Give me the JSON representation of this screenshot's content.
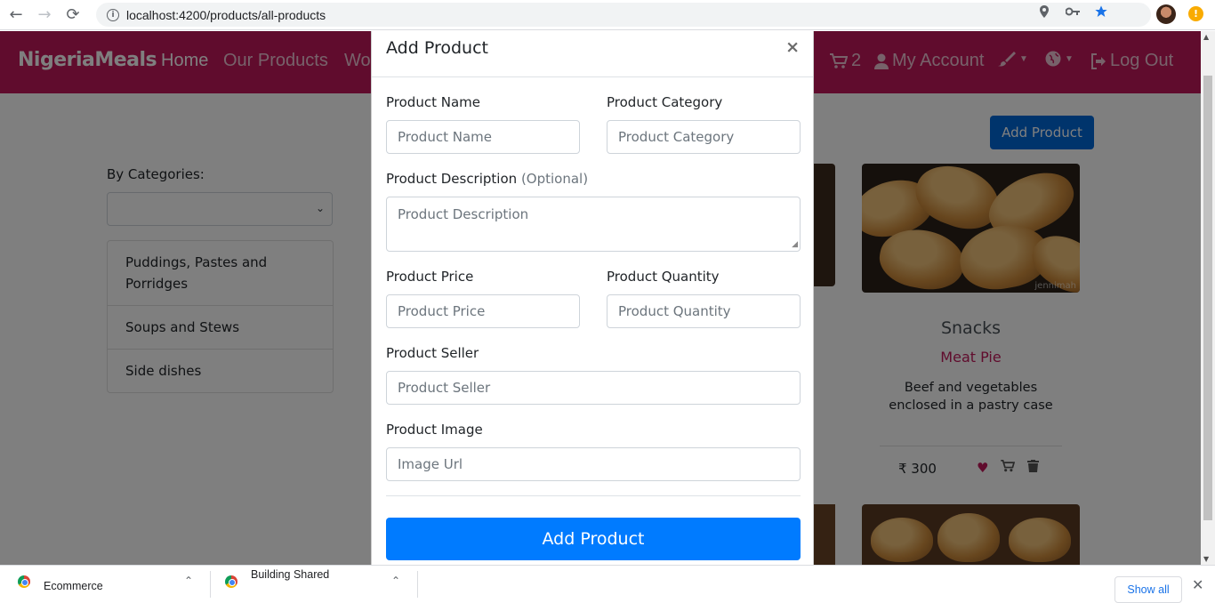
{
  "browser": {
    "url": "localhost:4200/products/all-products"
  },
  "navbar": {
    "brand": "NigeriaMeals",
    "home": "Home",
    "our_products": "Our Products",
    "partial_link": "Wo",
    "cart_count": "2",
    "my_account": "My Account",
    "logout": "Log Out"
  },
  "sidebar": {
    "filter_label": "By Categories:",
    "categories": [
      "Puddings, Pastes and Porridges",
      "Soups and Stews",
      "Side dishes"
    ]
  },
  "page": {
    "add_product_button": "Add Product"
  },
  "card": {
    "title": "Snacks",
    "subtitle": "Meat Pie",
    "description": "Beef and vegetables enclosed in a pastry case",
    "price": "₹ 300",
    "image_watermark": "jennimah"
  },
  "modal": {
    "title": "Add Product",
    "close": "×",
    "fields": {
      "name_label": "Product Name",
      "name_placeholder": "Product Name",
      "category_label": "Product Category",
      "category_placeholder": "Product Category",
      "description_label": "Product Description",
      "description_optional": "(Optional)",
      "description_placeholder": "Product Description",
      "price_label": "Product Price",
      "price_placeholder": "Product Price",
      "quantity_label": "Product Quantity",
      "quantity_placeholder": "Product Quantity",
      "seller_label": "Product Seller",
      "seller_placeholder": "Product Seller",
      "image_label": "Product Image",
      "image_placeholder": "Image Url"
    },
    "submit": "Add Product"
  },
  "downloads": {
    "items": [
      "Ecommerce",
      "Building Shared"
    ],
    "show_all": "Show all"
  },
  "colors": {
    "brand": "#c0185a",
    "primary": "#007bff"
  }
}
